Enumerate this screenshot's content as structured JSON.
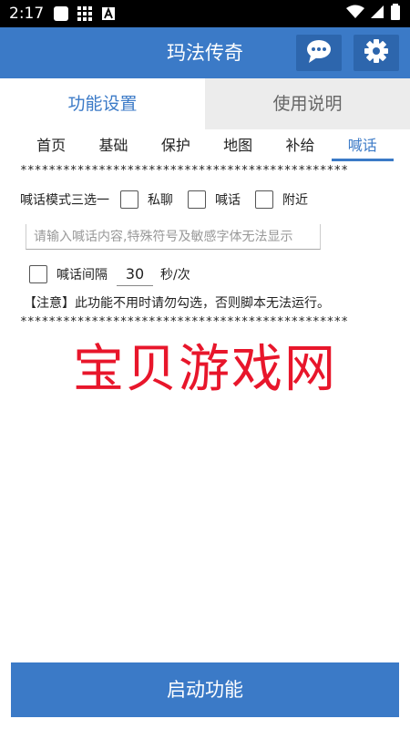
{
  "statusbar": {
    "time": "2:17"
  },
  "appbar": {
    "title": "玛法传奇"
  },
  "main_tabs": [
    {
      "label": "功能设置",
      "active": true
    },
    {
      "label": "使用说明",
      "active": false
    }
  ],
  "sub_tabs": [
    {
      "label": "首页",
      "active": false
    },
    {
      "label": "基础",
      "active": false
    },
    {
      "label": "保护",
      "active": false
    },
    {
      "label": "地图",
      "active": false
    },
    {
      "label": "补给",
      "active": false
    },
    {
      "label": "喊话",
      "active": true
    }
  ],
  "separator": "**********************************************",
  "shout_mode": {
    "label": "喊话模式三选一",
    "options": [
      "私聊",
      "喊话",
      "附近"
    ]
  },
  "shout_input": {
    "value": "",
    "placeholder": "请输入喊话内容,特殊符号及敏感字体无法显示"
  },
  "interval": {
    "label": "喊话间隔",
    "value": "30",
    "unit": "秒/次"
  },
  "notice": "【注意】此功能不用时请勿勾选，否则脚本无法运行。",
  "watermark": "宝贝游戏网",
  "start_button": {
    "label": "启动功能"
  },
  "colors": {
    "primary": "#3b7ac7",
    "watermark": "#e8162b",
    "status_bar": "#000000"
  }
}
